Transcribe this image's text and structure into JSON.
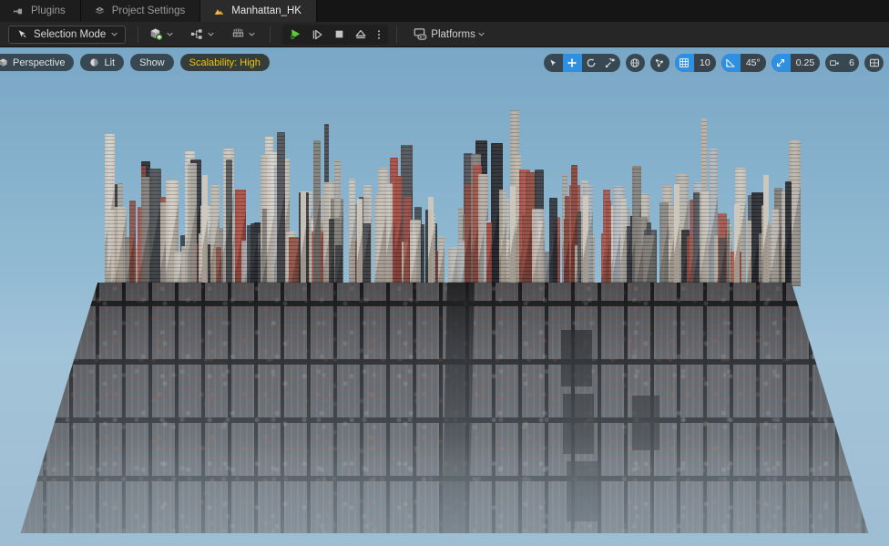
{
  "window": {
    "title": "Manhattan_HK"
  },
  "tabs": [
    {
      "label": "Plugins",
      "icon": "plug-icon",
      "active": false
    },
    {
      "label": "Project Settings",
      "icon": "project-settings-icon",
      "active": false
    },
    {
      "label": "Manhattan_HK",
      "icon": "level-icon",
      "active": true
    }
  ],
  "toolbar": {
    "selection_mode": {
      "label": "Selection Mode",
      "icon": "cursor-select-icon"
    },
    "create": {
      "icon": "add-actor-icon",
      "label": ""
    },
    "blueprints": {
      "icon": "blueprint-icon",
      "label": ""
    },
    "cinematics": {
      "icon": "cinematics-icon",
      "label": ""
    },
    "play": {
      "icon": "play-icon",
      "label": "Play"
    },
    "skip": {
      "icon": "step-icon",
      "label": "Skip"
    },
    "stop": {
      "icon": "stop-icon",
      "label": "Stop"
    },
    "eject": {
      "icon": "eject-icon",
      "label": "Eject"
    },
    "more": {
      "icon": "kebab-menu-icon",
      "label": "More"
    },
    "platforms": {
      "label": "Platforms",
      "icon": "platforms-icon"
    }
  },
  "viewport": {
    "view_mode": {
      "label": "Perspective",
      "icon": "perspective-cube-icon"
    },
    "lighting_mode": {
      "label": "Lit",
      "icon": "lit-sphere-icon"
    },
    "show_menu": {
      "label": "Show"
    },
    "scalability": {
      "label": "Scalability: High",
      "color": "#f2c211"
    },
    "gizmo": {
      "select": {
        "icon": "select-arrow-icon",
        "active": false
      },
      "translate": {
        "icon": "move-gizmo-icon",
        "active": true
      },
      "rotate": {
        "icon": "rotate-gizmo-icon",
        "active": false
      },
      "scale": {
        "icon": "scale-gizmo-icon",
        "active": false
      }
    },
    "coordinate_system": {
      "icon": "world-globe-icon",
      "active": false
    },
    "surface_snap": {
      "icon": "surface-snap-icon",
      "active": false
    },
    "grid_snap": {
      "icon": "grid-snap-icon",
      "active": true,
      "value": "10"
    },
    "angle_snap": {
      "icon": "angle-snap-icon",
      "active": true,
      "value": "45°"
    },
    "scale_snap": {
      "icon": "scale-snap-icon",
      "active": true,
      "value": "0.25"
    },
    "camera_speed": {
      "icon": "camera-speed-icon",
      "value": "6"
    },
    "maximize": {
      "icon": "viewport-layout-icon"
    }
  },
  "scene": {
    "name": "Manhattan_HK",
    "description": "Aerial perspective of a large Manhattan city block model on a flat plate against a blue sky",
    "sky_color": "#8fb6d0",
    "ground_color": "#4c4e53"
  }
}
